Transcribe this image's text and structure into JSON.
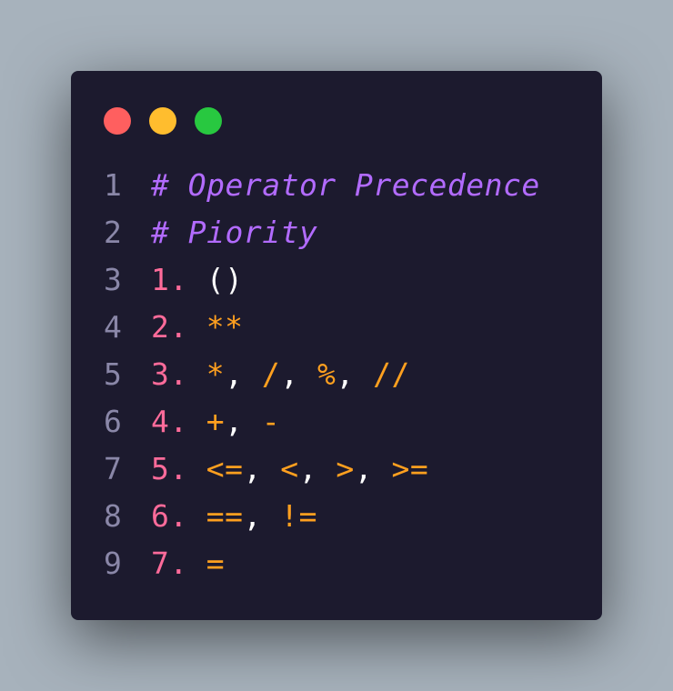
{
  "colors": {
    "background": "#a7b2bc",
    "window": "#1c1a2e",
    "close": "#ff5f5f",
    "minimize": "#ffbd2e",
    "maximize": "#28c840",
    "line_number": "#8a87a8",
    "comment": "#b26bff",
    "number": "#ff6b9a",
    "operator": "#ffa01f",
    "punctuation": "#ffffff"
  },
  "window_controls": [
    "close-dot",
    "minimize-dot",
    "maximize-dot"
  ],
  "lines": [
    {
      "n": "1",
      "comment": "# Operator Precedence"
    },
    {
      "n": "2",
      "comment": "# Piority"
    },
    {
      "n": "3",
      "num": "1.",
      "tokens": [
        {
          "t": "()",
          "k": "punct"
        }
      ]
    },
    {
      "n": "4",
      "num": "2.",
      "tokens": [
        {
          "t": "**",
          "k": "op"
        }
      ]
    },
    {
      "n": "5",
      "num": "3.",
      "tokens": [
        {
          "t": "*",
          "k": "op"
        },
        {
          "t": ", ",
          "k": "punct"
        },
        {
          "t": "/",
          "k": "op"
        },
        {
          "t": ", ",
          "k": "punct"
        },
        {
          "t": "%",
          "k": "op"
        },
        {
          "t": ", ",
          "k": "punct"
        },
        {
          "t": "//",
          "k": "op"
        }
      ]
    },
    {
      "n": "6",
      "num": "4.",
      "tokens": [
        {
          "t": "+",
          "k": "op"
        },
        {
          "t": ", ",
          "k": "punct"
        },
        {
          "t": "-",
          "k": "op"
        }
      ]
    },
    {
      "n": "7",
      "num": "5.",
      "tokens": [
        {
          "t": "<=",
          "k": "op"
        },
        {
          "t": ", ",
          "k": "punct"
        },
        {
          "t": "<",
          "k": "op"
        },
        {
          "t": ", ",
          "k": "punct"
        },
        {
          "t": ">",
          "k": "op"
        },
        {
          "t": ", ",
          "k": "punct"
        },
        {
          "t": ">=",
          "k": "op"
        }
      ]
    },
    {
      "n": "8",
      "num": "6.",
      "tokens": [
        {
          "t": "==",
          "k": "op"
        },
        {
          "t": ", ",
          "k": "punct"
        },
        {
          "t": "!=",
          "k": "op"
        }
      ]
    },
    {
      "n": "9",
      "num": "7.",
      "tokens": [
        {
          "t": "=",
          "k": "op"
        }
      ]
    }
  ]
}
